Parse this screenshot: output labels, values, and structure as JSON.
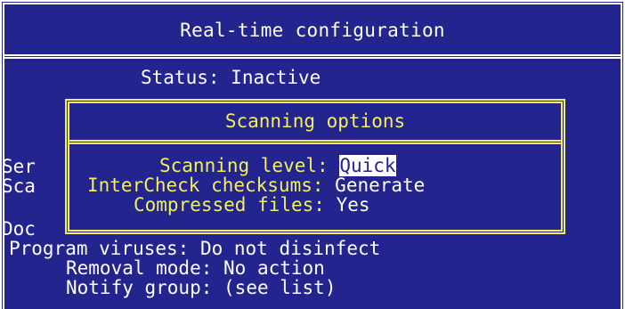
{
  "colors": {
    "background": "#24248f",
    "text": "#ffffff",
    "dialog_accent": "#f2ee62",
    "selection_background": "#ffffff",
    "selection_text": "#24248f"
  },
  "window": {
    "title": "Real-time configuration"
  },
  "status": {
    "label": "Status:",
    "value": "Inactive"
  },
  "background_labels": {
    "ser": "Ser",
    "sca": "Sca",
    "doc": "Doc"
  },
  "dialog": {
    "title": "Scanning options",
    "options": [
      {
        "label": "Scanning level:",
        "value": "Quick",
        "selected": true
      },
      {
        "label": "InterCheck checksums:",
        "value": "Generate",
        "selected": false
      },
      {
        "label": "Compressed files:",
        "value": "Yes",
        "selected": false
      }
    ]
  },
  "settings": {
    "program_viruses": {
      "label": "Program viruses:",
      "value": "Do not disinfect"
    },
    "removal_mode": {
      "label": "Removal mode:",
      "value": "No action"
    },
    "notify_group": {
      "label": "Notify group:",
      "value": "(see list)"
    }
  }
}
